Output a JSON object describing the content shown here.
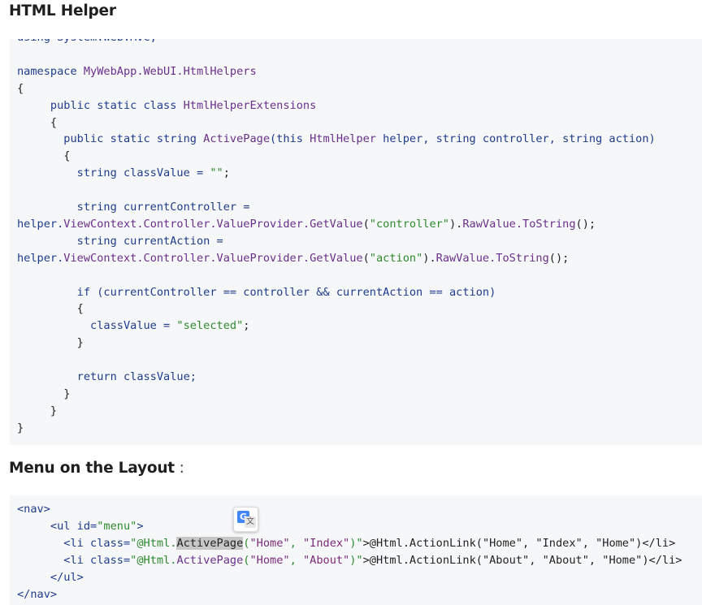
{
  "headings": {
    "html_helper": "HTML Helper",
    "menu_on_layout": "Menu on the Layout",
    "menu_on_layout_suffix": " :"
  },
  "code_block_1": {
    "lines": [
      [
        {
          "t": "using System.Web.Mvc;",
          "c": "kw"
        }
      ],
      [],
      [
        {
          "t": "namespace ",
          "c": "kw"
        },
        {
          "t": "MyWebApp.WebUI.HtmlHelpers",
          "c": "ty"
        }
      ],
      [
        {
          "t": "{",
          "c": "pl"
        }
      ],
      [
        {
          "t": "     public static class ",
          "c": "kw"
        },
        {
          "t": "HtmlHelperExtensions",
          "c": "ty"
        }
      ],
      [
        {
          "t": "     {",
          "c": "pl"
        }
      ],
      [
        {
          "t": "       public static string ",
          "c": "kw"
        },
        {
          "t": "ActivePage",
          "c": "ty"
        },
        {
          "t": "(this ",
          "c": "kw"
        },
        {
          "t": "HtmlHelper",
          "c": "ty"
        },
        {
          "t": " helper, string controller, string action)",
          "c": "kw"
        }
      ],
      [
        {
          "t": "       {",
          "c": "pl"
        }
      ],
      [
        {
          "t": "         string classValue = ",
          "c": "kw"
        },
        {
          "t": "\"\"",
          "c": "str"
        },
        {
          "t": ";",
          "c": "pl"
        }
      ],
      [],
      [
        {
          "t": "         string currentController =",
          "c": "kw"
        }
      ],
      [
        {
          "t": "helper.",
          "c": "kw"
        },
        {
          "t": "ViewContext.Controller.ValueProvider.GetValue",
          "c": "ty"
        },
        {
          "t": "(",
          "c": "pl"
        },
        {
          "t": "\"controller\"",
          "c": "str"
        },
        {
          "t": ").",
          "c": "pl"
        },
        {
          "t": "RawValue.ToString",
          "c": "ty"
        },
        {
          "t": "();",
          "c": "pl"
        }
      ],
      [
        {
          "t": "         string currentAction =",
          "c": "kw"
        }
      ],
      [
        {
          "t": "helper.",
          "c": "kw"
        },
        {
          "t": "ViewContext.Controller.ValueProvider.GetValue",
          "c": "ty"
        },
        {
          "t": "(",
          "c": "pl"
        },
        {
          "t": "\"action\"",
          "c": "str"
        },
        {
          "t": ").",
          "c": "pl"
        },
        {
          "t": "RawValue.ToString",
          "c": "ty"
        },
        {
          "t": "();",
          "c": "pl"
        }
      ],
      [],
      [
        {
          "t": "         if (currentController == controller && currentAction == action)",
          "c": "kw"
        }
      ],
      [
        {
          "t": "         {",
          "c": "pl"
        }
      ],
      [
        {
          "t": "           classValue = ",
          "c": "kw"
        },
        {
          "t": "\"selected\"",
          "c": "str"
        },
        {
          "t": ";",
          "c": "pl"
        }
      ],
      [
        {
          "t": "         }",
          "c": "pl"
        }
      ],
      [],
      [
        {
          "t": "         return classValue;",
          "c": "kw"
        }
      ],
      [
        {
          "t": "       }",
          "c": "pl"
        }
      ],
      [
        {
          "t": "     }",
          "c": "pl"
        }
      ],
      [
        {
          "t": "}",
          "c": "pl"
        }
      ]
    ]
  },
  "code_block_2": {
    "lines": [
      [
        {
          "t": "<nav>",
          "c": "kw"
        }
      ],
      [
        {
          "t": "     <ul id=",
          "c": "kw"
        },
        {
          "t": "\"menu\"",
          "c": "str"
        },
        {
          "t": ">",
          "c": "kw"
        }
      ],
      [
        {
          "t": "       <li class=",
          "c": "kw"
        },
        {
          "t": "\"@Html.",
          "c": "str"
        },
        {
          "t": "ActivePage",
          "c": "hl"
        },
        {
          "t": "(",
          "c": "str"
        },
        {
          "t": "\"Home\"",
          "c": "mid"
        },
        {
          "t": ", ",
          "c": "str"
        },
        {
          "t": "\"Index\"",
          "c": "mid"
        },
        {
          "t": ")\"",
          "c": "str"
        },
        {
          "t": ">@Html.ActionLink(\"Home\", \"Index\", \"Home\")</li>",
          "c": "pl"
        }
      ],
      [
        {
          "t": "       <li class=",
          "c": "kw"
        },
        {
          "t": "\"@Html.",
          "c": "str"
        },
        {
          "t": "ActivePage",
          "c": "ty"
        },
        {
          "t": "(",
          "c": "str"
        },
        {
          "t": "\"Home\"",
          "c": "mid"
        },
        {
          "t": ", ",
          "c": "str"
        },
        {
          "t": "\"About\"",
          "c": "mid"
        },
        {
          "t": ")\"",
          "c": "str"
        },
        {
          "t": ">@Html.ActionLink(\"About\", \"About\", \"Home\")</li>",
          "c": "pl"
        }
      ],
      [
        {
          "t": "     </ul>",
          "c": "kw"
        }
      ],
      [
        {
          "t": "</nav>",
          "c": "kw"
        }
      ]
    ]
  },
  "translate_button": {
    "icon": "google-translate-icon",
    "glyph_g": "G",
    "glyph_x": "文"
  }
}
